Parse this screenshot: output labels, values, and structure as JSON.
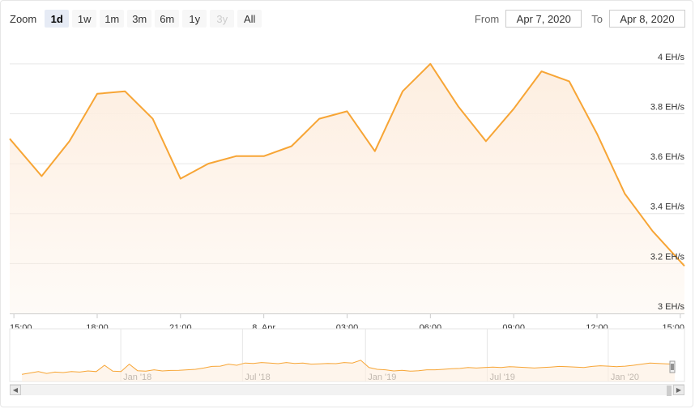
{
  "zoom": {
    "label": "Zoom",
    "buttons": [
      {
        "label": "1d",
        "state": "active"
      },
      {
        "label": "1w",
        "state": "normal"
      },
      {
        "label": "1m",
        "state": "normal"
      },
      {
        "label": "3m",
        "state": "normal"
      },
      {
        "label": "6m",
        "state": "normal"
      },
      {
        "label": "1y",
        "state": "normal"
      },
      {
        "label": "3y",
        "state": "disabled"
      },
      {
        "label": "All",
        "state": "normal"
      }
    ]
  },
  "range": {
    "from_label": "From",
    "from_value": "Apr 7, 2020",
    "to_label": "To",
    "to_value": "Apr 8, 2020"
  },
  "colors": {
    "line": "#f7a535",
    "fill": "#fdeee0",
    "grid": "#e6e6e6",
    "axis_text": "#333333",
    "navigator_text": "#666666"
  },
  "chart_data": {
    "type": "area",
    "title": "",
    "xlabel": "",
    "ylabel": "",
    "y_unit": "EH/s",
    "ylim": [
      3.0,
      4.1
    ],
    "y_ticks": [
      {
        "value": 3.0,
        "label": "3 EH/s"
      },
      {
        "value": 3.2,
        "label": "3.2 EH/s"
      },
      {
        "value": 3.4,
        "label": "3.4 EH/s"
      },
      {
        "value": 3.6,
        "label": "3.6 EH/s"
      },
      {
        "value": 3.8,
        "label": "3.8 EH/s"
      },
      {
        "value": 4.0,
        "label": "4 EH/s"
      }
    ],
    "x_unit": "hours from 15:00 on Apr 7",
    "xlim": [
      -0.15,
      24.15
    ],
    "x_ticks": [
      {
        "value": 0,
        "label": "15:00"
      },
      {
        "value": 3,
        "label": "18:00"
      },
      {
        "value": 6,
        "label": "21:00"
      },
      {
        "value": 9,
        "label": "8. Apr"
      },
      {
        "value": 12,
        "label": "03:00"
      },
      {
        "value": 15,
        "label": "06:00"
      },
      {
        "value": 18,
        "label": "09:00"
      },
      {
        "value": 21,
        "label": "12:00"
      },
      {
        "value": 24,
        "label": "15:00"
      }
    ],
    "series": [
      {
        "x": [
          -0.15,
          1,
          2,
          3,
          4,
          5,
          6,
          7,
          8,
          9,
          10,
          11,
          12,
          13,
          14,
          15,
          16,
          17,
          18,
          19,
          20,
          21,
          22,
          23,
          24.15
        ],
        "y": [
          3.7,
          3.55,
          3.69,
          3.88,
          3.89,
          3.78,
          3.54,
          3.6,
          3.63,
          3.63,
          3.67,
          3.78,
          3.81,
          3.65,
          3.89,
          4.0,
          3.83,
          3.69,
          3.82,
          3.97,
          3.93,
          3.72,
          3.48,
          3.33,
          3.19
        ]
      }
    ],
    "navigator": {
      "x_ticks": [
        {
          "value": 0.167,
          "label": "Jan '18"
        },
        {
          "value": 0.35,
          "label": "Jul '18"
        },
        {
          "value": 0.535,
          "label": "Jan '19"
        },
        {
          "value": 0.718,
          "label": "Jul '19"
        },
        {
          "value": 0.9,
          "label": "Jan '20"
        }
      ],
      "values": [
        0.1,
        0.16,
        0.22,
        0.14,
        0.2,
        0.18,
        0.22,
        0.2,
        0.25,
        0.22,
        0.5,
        0.24,
        0.22,
        0.55,
        0.26,
        0.24,
        0.3,
        0.25,
        0.27,
        0.28,
        0.3,
        0.32,
        0.38,
        0.45,
        0.46,
        0.55,
        0.5,
        0.6,
        0.58,
        0.62,
        0.6,
        0.57,
        0.62,
        0.58,
        0.6,
        0.55,
        0.56,
        0.58,
        0.57,
        0.62,
        0.6,
        0.72,
        0.4,
        0.32,
        0.3,
        0.25,
        0.28,
        0.24,
        0.26,
        0.3,
        0.3,
        0.32,
        0.35,
        0.36,
        0.4,
        0.38,
        0.4,
        0.42,
        0.4,
        0.44,
        0.42,
        0.4,
        0.38,
        0.4,
        0.42,
        0.45,
        0.44,
        0.42,
        0.4,
        0.45,
        0.48,
        0.46,
        0.44,
        0.46,
        0.5,
        0.55,
        0.6,
        0.58,
        0.56,
        0.55
      ]
    }
  }
}
